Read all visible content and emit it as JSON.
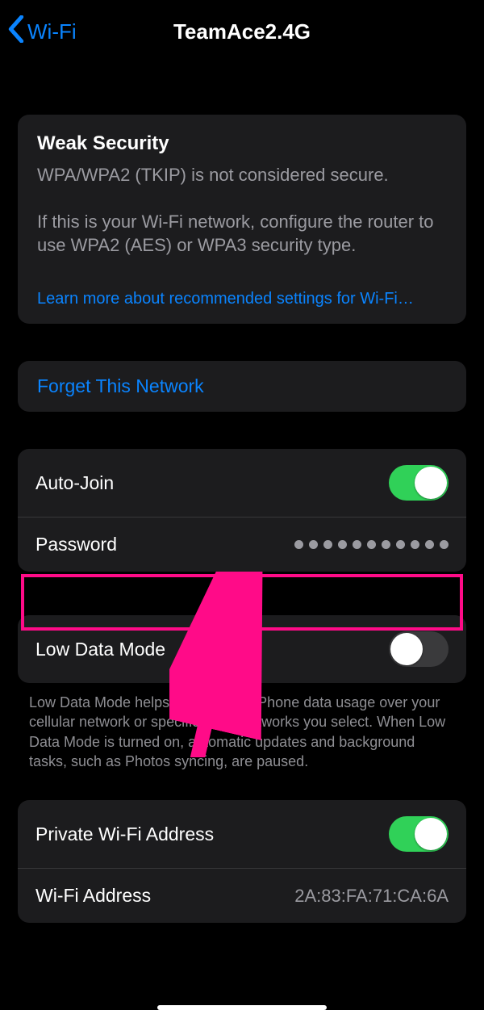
{
  "nav": {
    "back_label": "Wi-Fi",
    "title": "TeamAce2.4G"
  },
  "security": {
    "title": "Weak Security",
    "body1": "WPA/WPA2 (TKIP) is not considered secure.",
    "body2": "If this is your Wi-Fi network, configure the router to use WPA2 (AES) or WPA3 security type.",
    "learn_more": "Learn more about recommended settings for Wi-Fi…"
  },
  "forget": {
    "label": "Forget This Network"
  },
  "auto_join": {
    "label": "Auto-Join",
    "on": true
  },
  "password": {
    "label": "Password",
    "dots": 11
  },
  "low_data": {
    "label": "Low Data Mode",
    "on": false,
    "note": "Low Data Mode helps reduce your iPhone data usage over your cellular network or specific Wi-Fi networks you select. When Low Data Mode is turned on, automatic updates and background tasks, such as Photos syncing, are paused."
  },
  "private_addr": {
    "label": "Private Wi-Fi Address",
    "on": true
  },
  "wifi_addr": {
    "label": "Wi-Fi Address",
    "value": "2A:83:FA:71:CA:6A"
  },
  "colors": {
    "accent": "#0a84ff",
    "highlight": "#ff0b88",
    "toggle_on": "#30d158"
  }
}
